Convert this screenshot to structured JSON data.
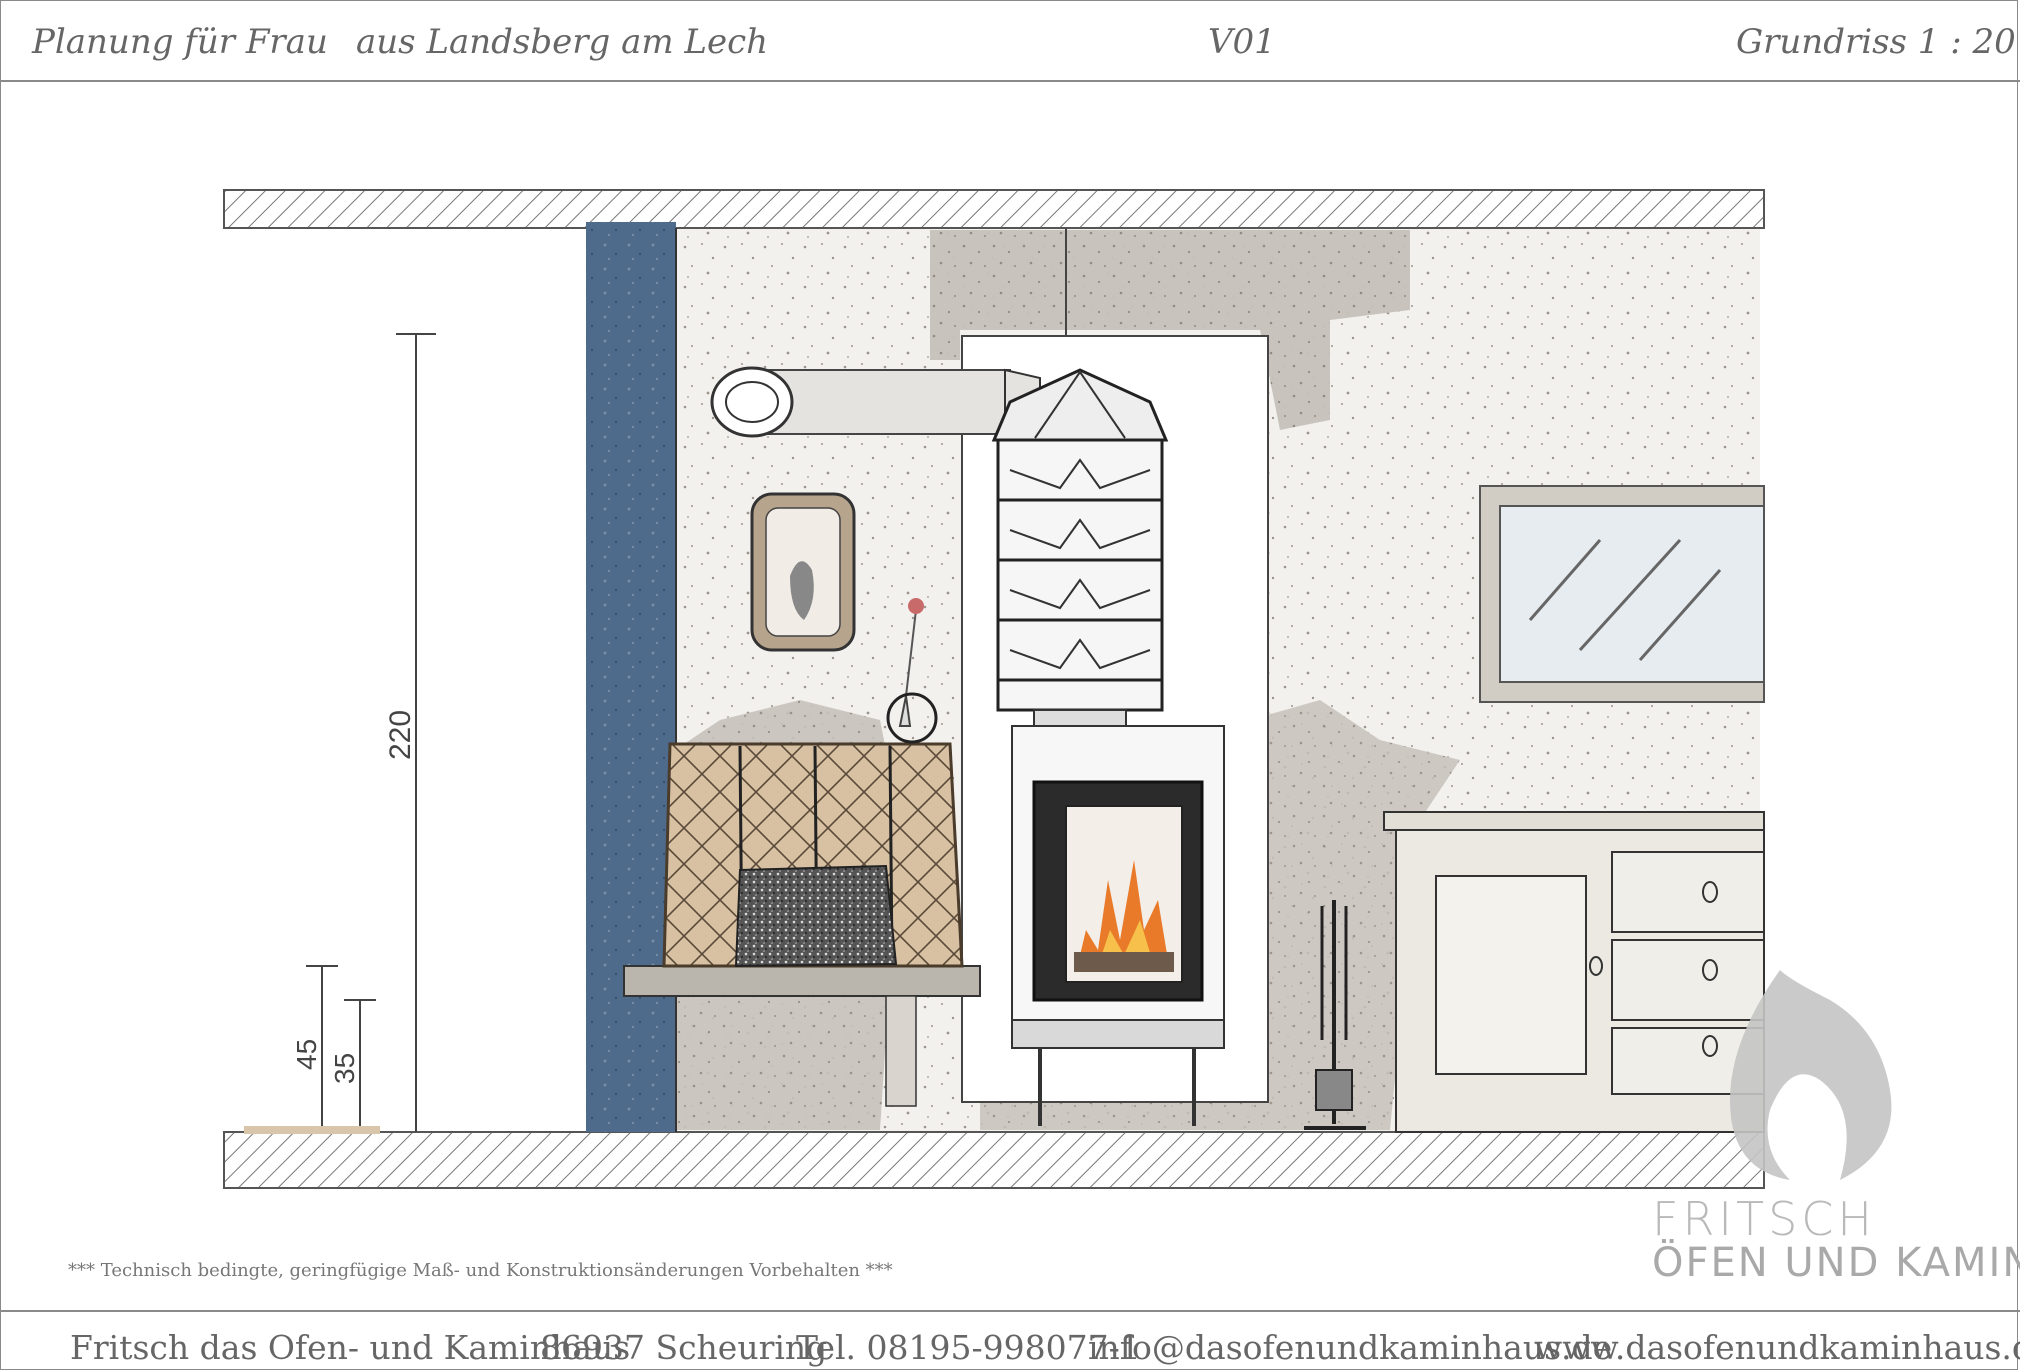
{
  "header": {
    "client_label": "Planung für Frau",
    "location": "aus Landsberg am Lech",
    "version": "V01",
    "plan_type": "Grundriss 1 : 20"
  },
  "drawing": {
    "dimensions": {
      "height_total": "220",
      "seat_height": "45",
      "bench_height": "35"
    }
  },
  "disclaimer": "***   Technisch bedingte, geringfügige Maß- und Konstruktionsänderungen Vorbehalten   ***",
  "logo": {
    "line1": "FRITSCH",
    "line2": "ÖFEN UND KAMINE"
  },
  "footer": {
    "company": "Fritsch das Ofen- und Kaminhaus",
    "address": "86937 Scheuring",
    "phone": "Tel. 08195-998077-1",
    "email": "info@dasofenundkaminhaus.de",
    "website": "www.dasofenundkaminhaus.de"
  },
  "colors": {
    "wall_blue": "#4d6a8c",
    "cushion_tan": "#d8c2a4",
    "wall_grey": "#c9c4bc",
    "flame_orange": "#e87a2a"
  }
}
